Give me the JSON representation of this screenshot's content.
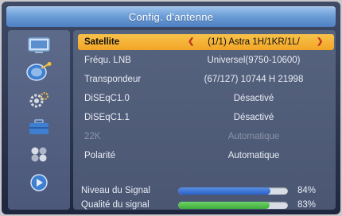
{
  "title": "Config. d'antenne",
  "sidebar": {
    "icons": [
      "tv-icon",
      "satellite-dish-icon",
      "gear-icon",
      "toolbox-icon",
      "games-icon",
      "media-icon"
    ]
  },
  "settings": [
    {
      "label": "Satellite",
      "value": "(1/1) Astra 1H/1KR/1L/",
      "selected": true
    },
    {
      "label": "Fréqu. LNB",
      "value": "Universel(9750-10600)"
    },
    {
      "label": "Transpondeur",
      "value": "(67/127) 10744 H 21998"
    },
    {
      "label": "DiSEqC1.0",
      "value": "Désactivé"
    },
    {
      "label": "DiSEqC1.1",
      "value": "Désactivé"
    },
    {
      "label": "22K",
      "value": "Automatique",
      "disabled": true
    },
    {
      "label": "Polarité",
      "value": "Automatique"
    }
  ],
  "signal": {
    "level_label": "Niveau du Signal",
    "level_value": 84,
    "level_text": "84%",
    "level_color": "#2a63c8",
    "quality_label": "Qualité du signal",
    "quality_value": 83,
    "quality_text": "83%",
    "quality_color": "#3fae3a"
  },
  "colors": {
    "selected_row": "#f2a526",
    "title_bar": "#6f9fd8"
  }
}
